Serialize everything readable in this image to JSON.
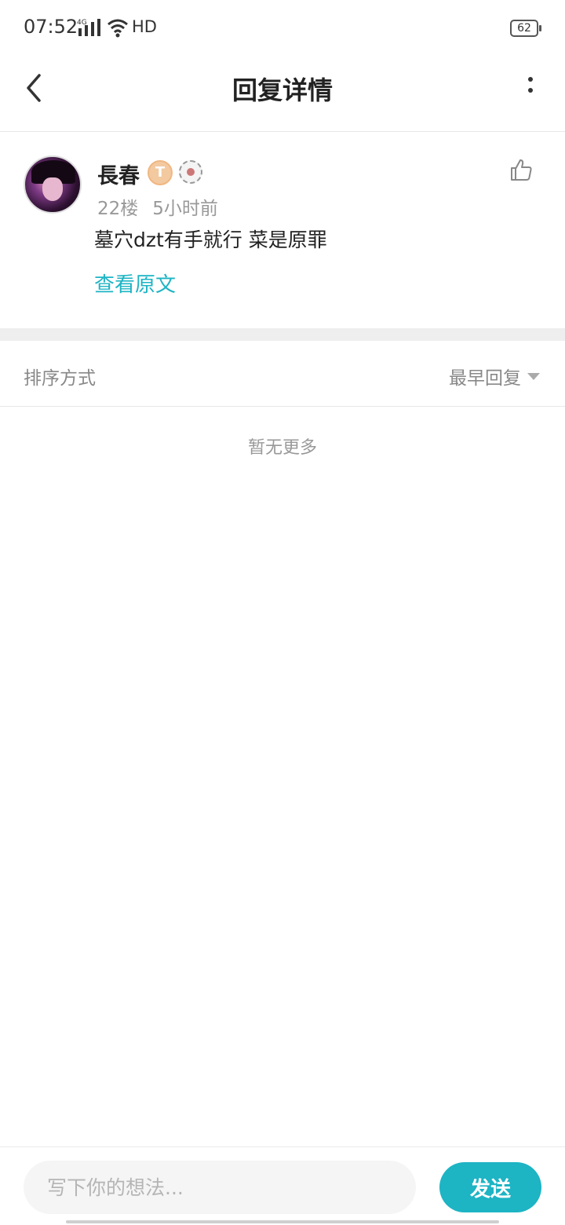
{
  "status_bar": {
    "time": "07:52",
    "network_type": "HD",
    "battery": "62"
  },
  "header": {
    "title": "回复详情",
    "back_icon": "chevron-left-icon",
    "more_icon": "more-vertical-icon"
  },
  "post": {
    "username": "長春",
    "level_badge": "T",
    "floor": "22楼",
    "time_ago": "5小时前",
    "content": "墓穴dzt有手就行 菜是原罪",
    "view_original": "查看原文",
    "like_icon": "thumbs-up-icon"
  },
  "sort": {
    "label": "排序方式",
    "value": "最早回复"
  },
  "empty_text": "暂无更多",
  "composer": {
    "placeholder": "写下你的想法...",
    "send_label": "发送"
  },
  "colors": {
    "accent": "#1db4c4",
    "divider": "#eeeeee",
    "muted_text": "#999999"
  }
}
